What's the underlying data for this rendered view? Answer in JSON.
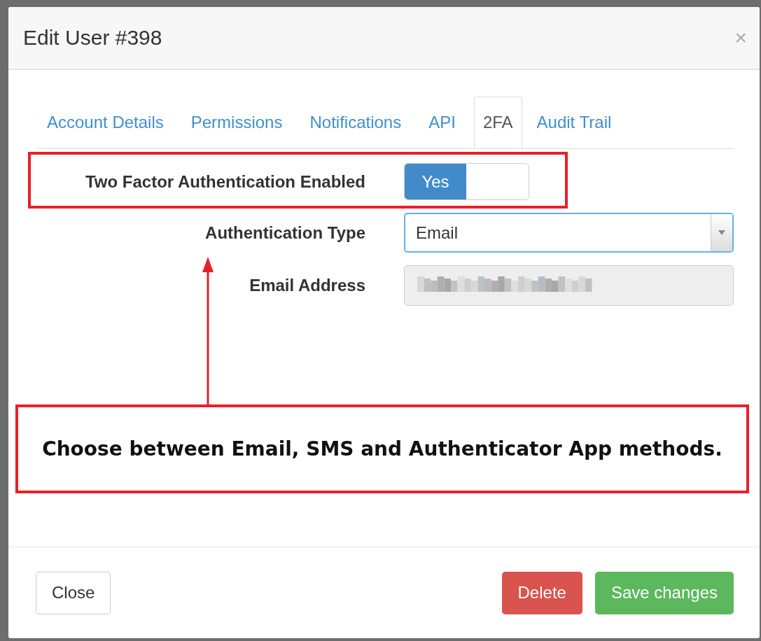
{
  "modal": {
    "title": "Edit User #398",
    "close_icon": "×"
  },
  "tabs": [
    {
      "label": "Account Details",
      "selected": false
    },
    {
      "label": "Permissions",
      "selected": false
    },
    {
      "label": "Notifications",
      "selected": false
    },
    {
      "label": "API",
      "selected": false
    },
    {
      "label": "2FA",
      "selected": true
    },
    {
      "label": "Audit Trail",
      "selected": false
    }
  ],
  "fields": [
    {
      "kind": "toggle",
      "label": "Two Factor Authentication Enabled",
      "on": true,
      "toggle_label": "Yes"
    },
    {
      "kind": "select",
      "label": "Authentication Type",
      "value": "Email"
    },
    {
      "kind": "redacted",
      "label": "Email Address",
      "disabled": true
    }
  ],
  "annotation": {
    "text": "Choose between Email, SMS and Authenticator App methods."
  },
  "buttons": [
    {
      "kind": "default",
      "label": "Close"
    },
    {
      "kind": "danger",
      "label": "Delete"
    },
    {
      "kind": "success",
      "label": "Save changes"
    }
  ]
}
